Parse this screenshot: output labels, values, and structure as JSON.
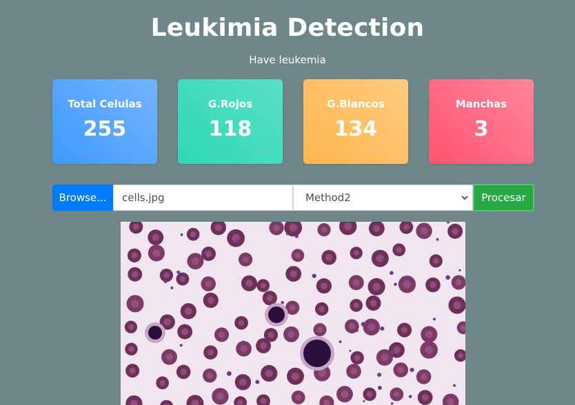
{
  "header": {
    "title": "Leukimia Detection",
    "result": "Have leukemia"
  },
  "stats": [
    {
      "label": "Total Celulas",
      "value": "255",
      "color": "#4099ff"
    },
    {
      "label": "G.Rojos",
      "value": "118",
      "color": "#2ed8b6"
    },
    {
      "label": "G.Blancos",
      "value": "134",
      "color": "#ffb64d"
    },
    {
      "label": "Manchas",
      "value": "3",
      "color": "#ff5370"
    }
  ],
  "form": {
    "browse_label": "Browse...",
    "file_name": "cells.jpg",
    "method_selected": "Method2",
    "process_label": "Procesar"
  },
  "image": {
    "description_name": "blood-smear-image"
  }
}
